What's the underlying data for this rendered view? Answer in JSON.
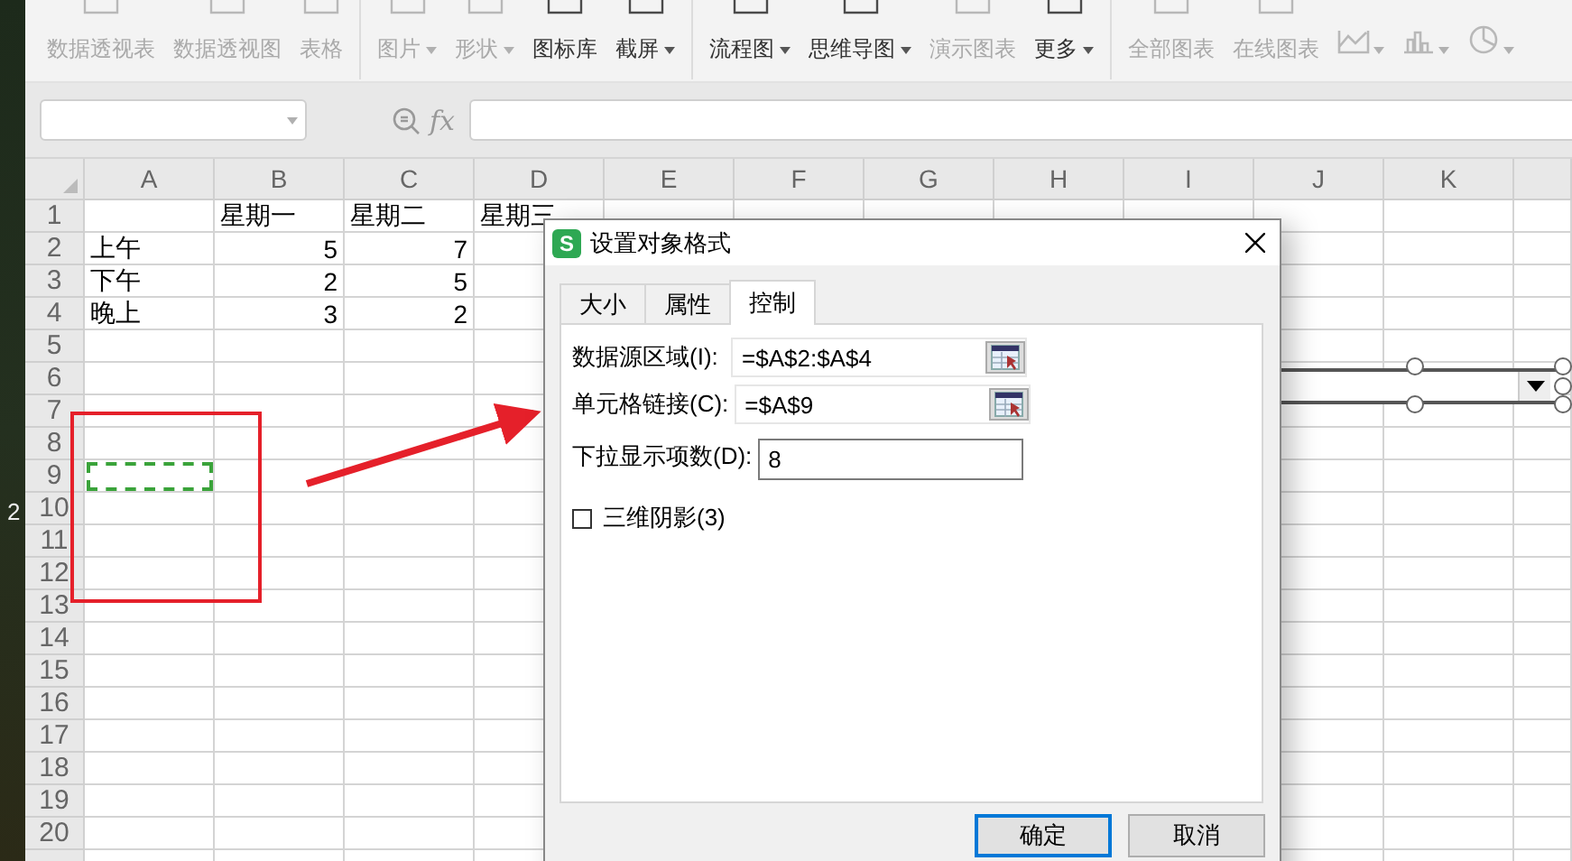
{
  "desktop_text": "2",
  "ribbon": {
    "groups": [
      {
        "items": [
          {
            "kind": "text",
            "label": "数据透视表",
            "disabled": true,
            "dropdown": false
          },
          {
            "kind": "text",
            "label": "数据透视图",
            "disabled": true,
            "dropdown": false
          },
          {
            "kind": "text",
            "label": "表格",
            "disabled": true,
            "dropdown": false
          }
        ]
      },
      {
        "items": [
          {
            "kind": "text",
            "label": "图片",
            "disabled": true,
            "dropdown": true
          },
          {
            "kind": "text",
            "label": "形状",
            "disabled": true,
            "dropdown": true
          },
          {
            "kind": "text",
            "label": "图标库",
            "disabled": false,
            "dropdown": false
          },
          {
            "kind": "text",
            "label": "截屏",
            "disabled": false,
            "dropdown": true
          }
        ]
      },
      {
        "items": [
          {
            "kind": "text",
            "label": "流程图",
            "disabled": false,
            "dropdown": true
          },
          {
            "kind": "text",
            "label": "思维导图",
            "disabled": false,
            "dropdown": true
          },
          {
            "kind": "text",
            "label": "演示图表",
            "disabled": true,
            "dropdown": false
          },
          {
            "kind": "text",
            "label": "更多",
            "disabled": false,
            "dropdown": true
          }
        ]
      },
      {
        "items": [
          {
            "kind": "text",
            "label": "全部图表",
            "disabled": true,
            "dropdown": false
          },
          {
            "kind": "text",
            "label": "在线图表",
            "disabled": true,
            "dropdown": false
          },
          {
            "kind": "linechart",
            "disabled": true,
            "dropdown": true
          },
          {
            "kind": "barchart",
            "disabled": true,
            "dropdown": true
          },
          {
            "kind": "piechart",
            "disabled": true,
            "dropdown": true
          }
        ]
      }
    ]
  },
  "formula_bar": {
    "label": "fx"
  },
  "sheet": {
    "columns": [
      "A",
      "B",
      "C",
      "D",
      "E",
      "F",
      "G",
      "H",
      "I",
      "J",
      "K"
    ],
    "rows": [
      {
        "header": "1",
        "cells": [
          {
            "kind": "empty",
            "selected": false
          },
          {
            "kind": "text",
            "text": "星期一",
            "selected": false
          },
          {
            "kind": "text",
            "text": "星期二",
            "selected": false
          },
          {
            "kind": "text",
            "text": "星期三",
            "selected": false
          }
        ]
      },
      {
        "header": "2",
        "cells": [
          {
            "kind": "text",
            "text": "上午",
            "selected": false
          },
          {
            "kind": "number",
            "text": "5",
            "selected": false
          },
          {
            "kind": "number",
            "text": "7",
            "selected": false
          }
        ]
      },
      {
        "header": "3",
        "cells": [
          {
            "kind": "text",
            "text": "下午",
            "selected": false
          },
          {
            "kind": "number",
            "text": "2",
            "selected": false
          },
          {
            "kind": "number",
            "text": "5",
            "selected": false
          }
        ]
      },
      {
        "header": "4",
        "cells": [
          {
            "kind": "text",
            "text": "晚上",
            "selected": false
          },
          {
            "kind": "number",
            "text": "3",
            "selected": false
          },
          {
            "kind": "number",
            "text": "2",
            "selected": false
          }
        ]
      },
      {
        "header": "5"
      },
      {
        "header": "6"
      },
      {
        "header": "7"
      },
      {
        "header": "8"
      },
      {
        "header": "9",
        "cells": [
          {
            "kind": "empty",
            "selected": true
          }
        ]
      },
      {
        "header": "10"
      },
      {
        "header": "11"
      },
      {
        "header": "12"
      },
      {
        "header": "13"
      },
      {
        "header": "14"
      },
      {
        "header": "15"
      },
      {
        "header": "16"
      },
      {
        "header": "17"
      },
      {
        "header": "18"
      },
      {
        "header": "19"
      },
      {
        "header": "20"
      }
    ]
  },
  "combo_control": {
    "selected": true
  },
  "dialog": {
    "icon_text": "S",
    "title": "设置对象格式",
    "tabs": [
      {
        "label": "大小",
        "selected": false
      },
      {
        "label": "属性",
        "selected": false
      },
      {
        "label": "控制",
        "selected": true
      }
    ],
    "fields": [
      {
        "kind": "range",
        "label": "数据源区域(I):",
        "value": "=$A$2:$A$4"
      },
      {
        "kind": "range",
        "label": "单元格链接(C):",
        "value": "=$A$9"
      },
      {
        "kind": "number",
        "label": "下拉显示项数(D):",
        "value": "8"
      }
    ],
    "checkbox": {
      "label": "三维阴影(3)",
      "checked": false
    },
    "buttons": [
      {
        "label": "确定",
        "default": true
      },
      {
        "label": "取消",
        "default": false
      }
    ]
  }
}
